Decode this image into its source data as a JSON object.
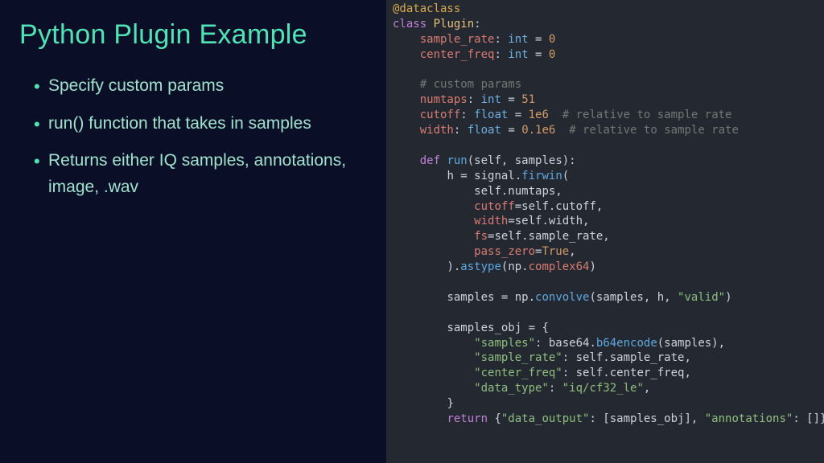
{
  "title": "Python Plugin Example",
  "bullets": [
    "Specify custom params",
    "run() function that takes in samples",
    "Returns either IQ samples, annotations, image, .wav"
  ],
  "code": {
    "decorator": "@dataclass",
    "class_kw": "class",
    "class_name": "Plugin",
    "field1_name": "sample_rate",
    "field1_type": "int",
    "field1_val": "0",
    "field2_name": "center_freq",
    "field2_type": "int",
    "field2_val": "0",
    "comment_custom": "# custom params",
    "field3_name": "numtaps",
    "field3_type": "int",
    "field3_val": "51",
    "field4_name": "cutoff",
    "field4_type": "float",
    "field4_val": "1e6",
    "field4_com": "# relative to sample rate",
    "field5_name": "width",
    "field5_type": "float",
    "field5_val": "0.1e6",
    "field5_com": "# relative to sample rate",
    "def_kw": "def",
    "run_name": "run",
    "run_params": "(self, samples):",
    "h_eq": "h = ",
    "signal": "signal",
    "firwin": "firwin",
    "arg_numtaps": "self.numtaps,",
    "kw_cutoff": "cutoff",
    "val_cutoff": "=self.cutoff,",
    "kw_width": "width",
    "val_width": "=self.width,",
    "kw_fs": "fs",
    "val_fs": "=self.sample_rate,",
    "kw_pz": "pass_zero",
    "val_pz_eq": "=",
    "val_true": "True",
    "close_firwin": ").",
    "astype": "astype",
    "np1": "np",
    "complex64": "complex64",
    "samples_eq": "samples = ",
    "np2": "np",
    "convolve": "convolve",
    "conv_args_a": "(samples, h, ",
    "conv_args_b": "\"valid\"",
    "conv_args_c": ")",
    "obj_line": "samples_obj = {",
    "k_samples": "\"samples\"",
    "v_samples_a": ": ",
    "base64": "base64",
    "b64encode": "b64encode",
    "v_samples_b": "(samples),",
    "k_rate": "\"sample_rate\"",
    "v_rate": ": self.sample_rate,",
    "k_cf": "\"center_freq\"",
    "v_cf": ": self.center_freq,",
    "k_dt": "\"data_type\"",
    "v_dt_a": ": ",
    "v_dt_b": "\"iq/cf32_le\"",
    "v_dt_c": ",",
    "close_brace": "}",
    "return_kw": "return",
    "ret_open": " {",
    "ret_k1": "\"data_output\"",
    "ret_v1": ": [samples_obj], ",
    "ret_k2": "\"annotations\"",
    "ret_v2": ": []}"
  }
}
